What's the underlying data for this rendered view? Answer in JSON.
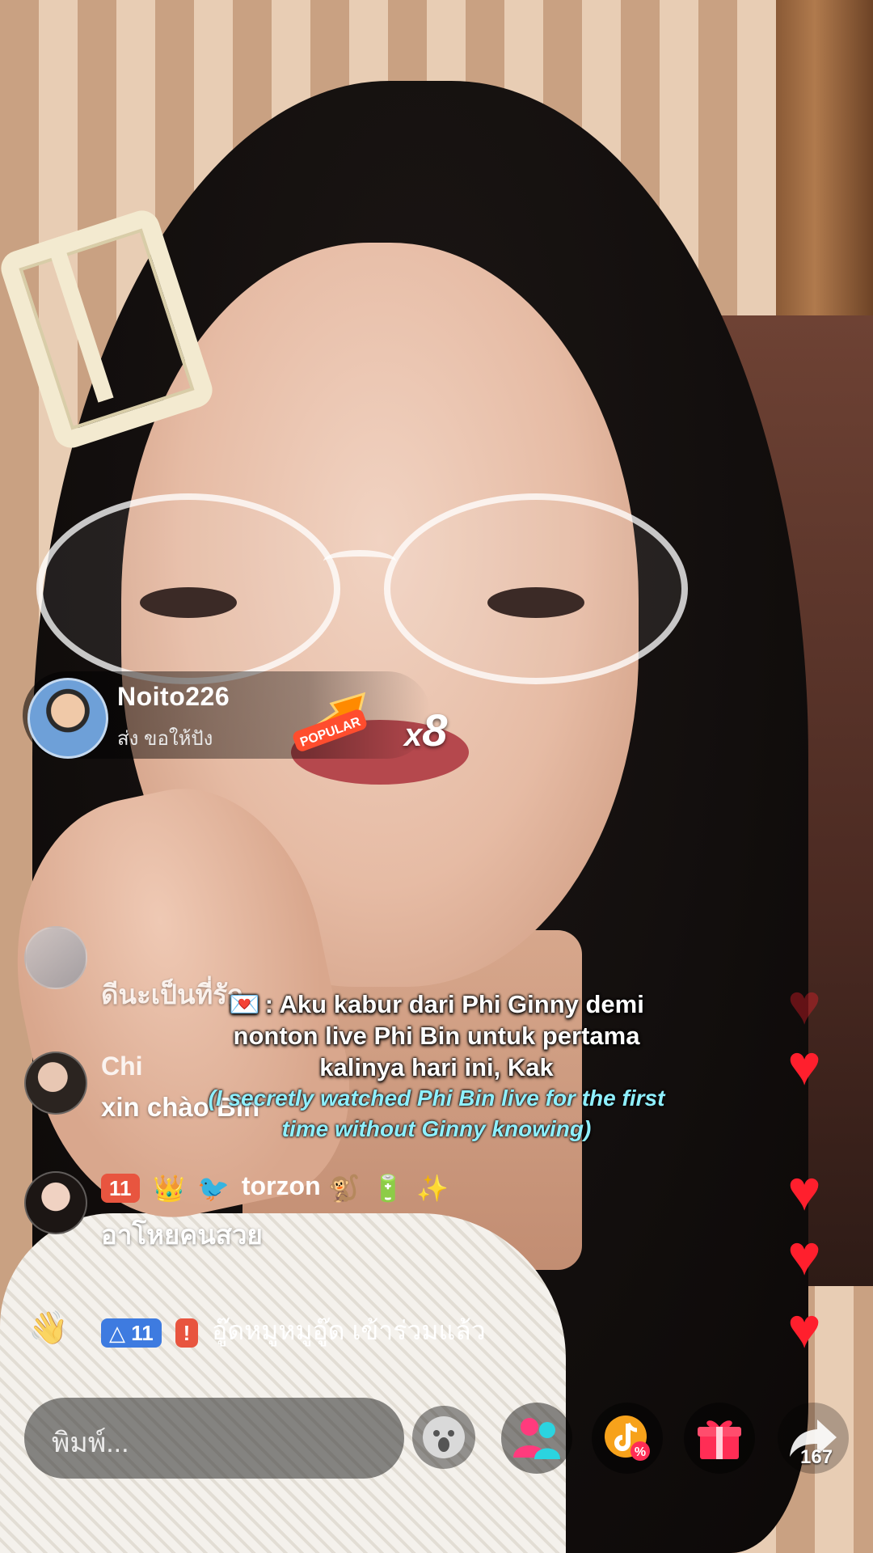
{
  "gift_notification": {
    "username": "Noito226",
    "action": "ส่ง ขอให้ปัง",
    "gift_badge": "POPULAR",
    "combo_prefix": "x",
    "combo_count": "8"
  },
  "comments": [
    {
      "name": "",
      "text": "ดีนะเป็นที่รัก"
    },
    {
      "name": "Chi",
      "text": "xin chào Bin"
    },
    {
      "badge": "11",
      "name": "torzon",
      "text": "อาโหยคนสวย"
    },
    {
      "level_badge": "11",
      "name": "อู๊ดหมูหมูอู๊ด",
      "text": "เข้าร่วมแล้ว"
    }
  ],
  "caption": {
    "text": ": Aku kabur dari Phi Ginny demi nonton live Phi Bin untuk pertama kalinya hari ini, Kak",
    "translation": "(I secretly watched Phi Bin live for the first time without Ginny knowing)"
  },
  "bottom_bar": {
    "input_placeholder": "พิมพ์...",
    "share_count": "167"
  },
  "colors": {
    "like_heart": "#ff1f2d",
    "translation_text": "#8ff0ff",
    "badge_orange": "#e8553f",
    "badge_blue": "#3e7be0"
  }
}
